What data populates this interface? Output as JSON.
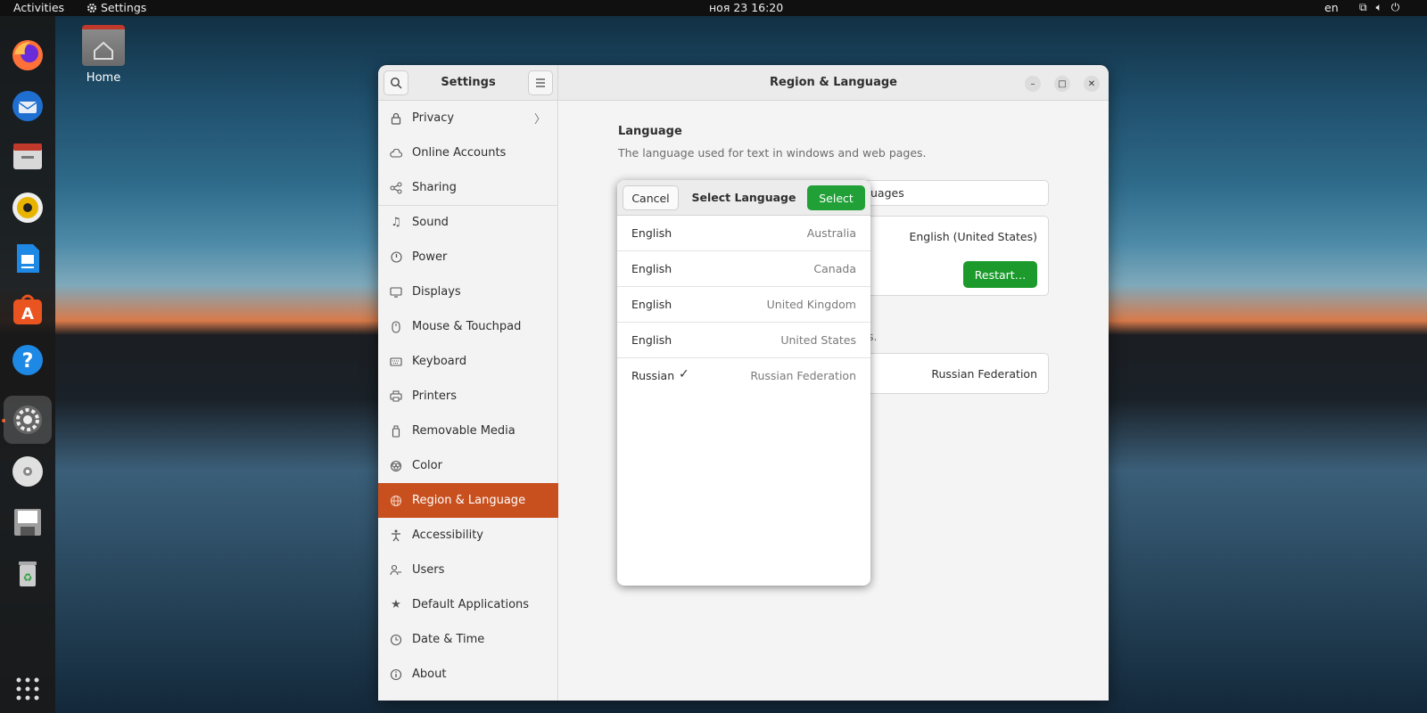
{
  "topbar": {
    "activities": "Activities",
    "app_name": "Settings",
    "clock": "ноя 23  16:20",
    "keyboard_layout": "en"
  },
  "desktop": {
    "home_label": "Home"
  },
  "dock": {
    "items": [
      "firefox-icon",
      "thunderbird-icon",
      "files-icon",
      "rhythmbox-icon",
      "libreoffice-writer-icon",
      "app-center-icon",
      "help-icon",
      "settings-icon",
      "disc-icon",
      "floppy-icon",
      "trash-icon",
      "app-grid-icon"
    ],
    "active": "settings-icon"
  },
  "window": {
    "sidebar_title": "Settings",
    "main_title": "Region & Language"
  },
  "sidebar": {
    "items": [
      {
        "label": "Privacy",
        "icon": "lock-icon"
      },
      {
        "label": "Online Accounts",
        "icon": "cloud-icon"
      },
      {
        "label": "Sharing",
        "icon": "share-icon"
      },
      {
        "label": "Sound",
        "icon": "music-note-icon"
      },
      {
        "label": "Power",
        "icon": "power-icon"
      },
      {
        "label": "Displays",
        "icon": "display-icon"
      },
      {
        "label": "Mouse & Touchpad",
        "icon": "mouse-icon"
      },
      {
        "label": "Keyboard",
        "icon": "keyboard-icon"
      },
      {
        "label": "Printers",
        "icon": "printer-icon"
      },
      {
        "label": "Removable Media",
        "icon": "usb-icon"
      },
      {
        "label": "Color",
        "icon": "color-icon"
      },
      {
        "label": "Region & Language",
        "icon": "globe-icon"
      },
      {
        "label": "Accessibility",
        "icon": "accessibility-icon"
      },
      {
        "label": "Users",
        "icon": "users-icon"
      },
      {
        "label": "Default Applications",
        "icon": "star-icon"
      },
      {
        "label": "Date & Time",
        "icon": "clock-icon"
      },
      {
        "label": "About",
        "icon": "info-icon"
      }
    ],
    "selected": "Region & Language"
  },
  "main": {
    "language_title": "Language",
    "language_desc": "The language used for text in windows and web pages.",
    "manage_languages_partial": "uages",
    "current_language": "English (United States)",
    "restart_label": "Restart…",
    "formats_desc_partial": "s.",
    "current_region": "Russian Federation"
  },
  "dialog": {
    "cancel_label": "Cancel",
    "title": "Select Language",
    "select_label": "Select",
    "rows": [
      {
        "language": "English",
        "region": "Australia",
        "checked": false
      },
      {
        "language": "English",
        "region": "Canada",
        "checked": false
      },
      {
        "language": "English",
        "region": "United Kingdom",
        "checked": false
      },
      {
        "language": "English",
        "region": "United States",
        "checked": false
      },
      {
        "language": "Russian",
        "region": "Russian Federation",
        "checked": true
      }
    ],
    "check_glyph": "✓"
  },
  "colors": {
    "accent": "#c8501f",
    "primary_button": "#21a038"
  }
}
